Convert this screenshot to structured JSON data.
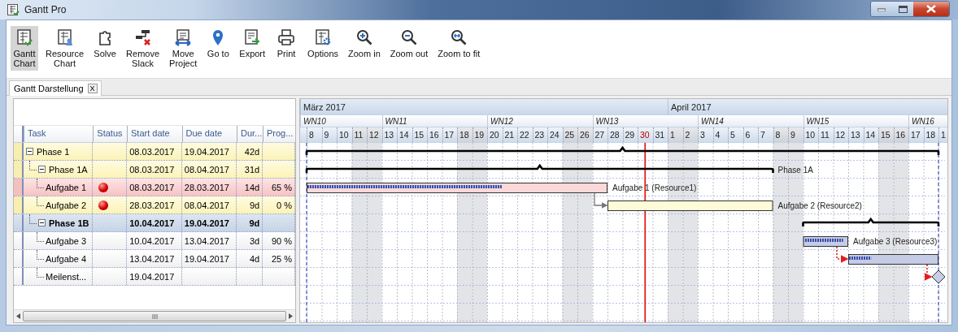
{
  "window": {
    "title": "Gantt Pro"
  },
  "toolbar": [
    {
      "label": "Gantt\nChart",
      "selected": true
    },
    {
      "label": "Resource\nChart",
      "selected": false
    },
    {
      "label": "Solve",
      "selected": false
    },
    {
      "label": "Remove\nSlack",
      "selected": false
    },
    {
      "label": "Move\nProject",
      "selected": false
    },
    {
      "label": "Go to",
      "selected": false
    },
    {
      "label": "Export",
      "selected": false
    },
    {
      "label": "Print",
      "selected": false
    },
    {
      "label": "Options",
      "selected": false
    },
    {
      "label": "Zoom in",
      "selected": false
    },
    {
      "label": "Zoom out",
      "selected": false
    },
    {
      "label": "Zoom to fit",
      "selected": false
    }
  ],
  "tabs": [
    {
      "label": "Gantt Darstellung",
      "close": "X",
      "selected": true
    }
  ],
  "grid": {
    "columns": [
      "Task",
      "Status",
      "Start date",
      "Due date",
      "Dur...",
      "Prog..."
    ],
    "rows": [
      {
        "name": "Phase 1",
        "kind": "summary",
        "expanded": true,
        "alert": false,
        "start": "08.03.2017",
        "due": "19.04.2017",
        "duration": "42d",
        "critical": true,
        "late": false,
        "selected": false,
        "dependency": false,
        "children": [
          {
            "name": "Phase 1A",
            "kind": "summary",
            "expanded": true,
            "alert": false,
            "start": "08.03.2017",
            "due": "08.04.2017",
            "duration": "31d",
            "critical": true,
            "late": false,
            "selected": false,
            "dependency": false,
            "bar_label": "Phase 1A",
            "children": [
              {
                "name": "Aufgabe 1",
                "kind": "task",
                "alert": true,
                "start": "08.03.2017",
                "due": "28.03.2017",
                "duration": "14d",
                "progress": "65 %",
                "level": 0.65,
                "critical": false,
                "late": true,
                "selected": false,
                "dependency": false,
                "bar_label": "Aufgabe 1 (Resource1)"
              },
              {
                "name": "Aufgabe 2",
                "kind": "task",
                "alert": true,
                "start": "28.03.2017",
                "due": "08.04.2017",
                "duration": "9d",
                "progress": "0 %",
                "level": 0,
                "critical": true,
                "late": false,
                "selected": false,
                "dependency": true,
                "dependency_dotted": false,
                "bar_label": "Aufgabe 2 (Resource2)"
              }
            ]
          },
          {
            "name": "Phase 1B",
            "kind": "summary",
            "expanded": true,
            "alert": false,
            "start": "10.04.2017",
            "due": "19.04.2017",
            "duration": "9d",
            "critical": false,
            "late": false,
            "selected": true,
            "dependency": false,
            "children": [
              {
                "name": "Aufgabe 3",
                "kind": "task",
                "alert": false,
                "start": "10.04.2017",
                "due": "13.04.2017",
                "duration": "3d",
                "progress": "90 %",
                "level": 0.9,
                "critical": false,
                "late": false,
                "selected": false,
                "dependency": false,
                "bar_label": "Aufgabe 3 (Resource3)"
              },
              {
                "name": "Aufgabe 4",
                "kind": "task",
                "alert": false,
                "start": "13.04.2017",
                "due": "19.04.2017",
                "duration": "4d",
                "progress": "25 %",
                "level": 0.25,
                "critical": false,
                "late": false,
                "selected": false,
                "dependency": true,
                "dependency_dotted": true
              },
              {
                "name": "Meilenst...",
                "kind": "milestone",
                "alert": false,
                "start": "19.04.2017",
                "critical": false,
                "late": false,
                "selected": false,
                "dependency": true,
                "dependency_dotted": true
              }
            ]
          }
        ]
      }
    ]
  },
  "gantt": {
    "months": [
      "März 2017",
      "April 2017"
    ],
    "weeks": [
      "WN10",
      "WN11",
      "WN12",
      "WN13",
      "WN14",
      "WN15",
      "WN16"
    ],
    "days": [
      {
        "label": "8",
        "weekend": false
      },
      {
        "label": "9",
        "weekend": false
      },
      {
        "label": "10",
        "weekend": false
      },
      {
        "label": "11",
        "weekend": true
      },
      {
        "label": "12",
        "weekend": true
      },
      {
        "label": "13",
        "weekend": false
      },
      {
        "label": "14",
        "weekend": false
      },
      {
        "label": "15",
        "weekend": false
      },
      {
        "label": "16",
        "weekend": false
      },
      {
        "label": "17",
        "weekend": false
      },
      {
        "label": "18",
        "weekend": true
      },
      {
        "label": "19",
        "weekend": true
      },
      {
        "label": "20",
        "weekend": false
      },
      {
        "label": "21",
        "weekend": false
      },
      {
        "label": "22",
        "weekend": false
      },
      {
        "label": "23",
        "weekend": false
      },
      {
        "label": "24",
        "weekend": false
      },
      {
        "label": "25",
        "weekend": true
      },
      {
        "label": "26",
        "weekend": true
      },
      {
        "label": "27",
        "weekend": false
      },
      {
        "label": "28",
        "weekend": false
      },
      {
        "label": "29",
        "weekend": false
      },
      {
        "label": "30",
        "weekend": false,
        "today": true
      },
      {
        "label": "31",
        "weekend": false
      },
      {
        "label": "1",
        "weekend": true
      },
      {
        "label": "2",
        "weekend": true
      },
      {
        "label": "3",
        "weekend": false
      },
      {
        "label": "4",
        "weekend": false
      },
      {
        "label": "5",
        "weekend": false
      },
      {
        "label": "6",
        "weekend": false
      },
      {
        "label": "7",
        "weekend": false
      },
      {
        "label": "8",
        "weekend": true
      },
      {
        "label": "9",
        "weekend": true
      },
      {
        "label": "10",
        "weekend": false
      },
      {
        "label": "11",
        "weekend": false
      },
      {
        "label": "12",
        "weekend": false
      },
      {
        "label": "13",
        "weekend": false
      },
      {
        "label": "14",
        "weekend": false
      },
      {
        "label": "15",
        "weekend": true
      },
      {
        "label": "16",
        "weekend": true
      },
      {
        "label": "17",
        "weekend": false
      },
      {
        "label": "18",
        "weekend": false
      },
      {
        "label": "1",
        "weekend": false
      }
    ]
  }
}
